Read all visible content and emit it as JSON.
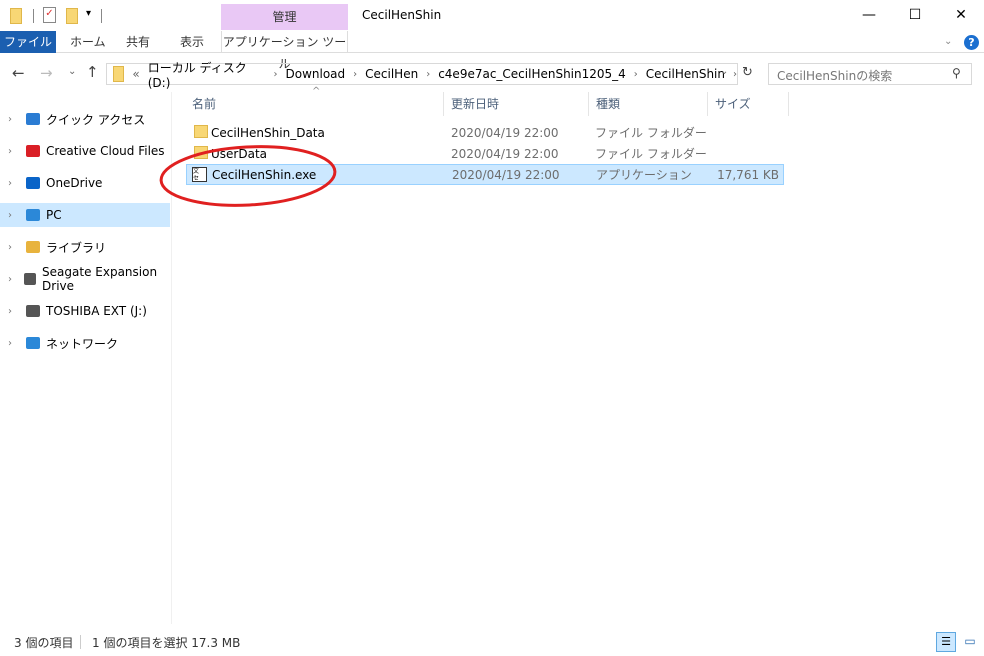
{
  "window": {
    "title": "CecilHenShin",
    "context_tab": "管理",
    "minimize": "—",
    "maximize": "☐",
    "close": "✕"
  },
  "ribbon": {
    "tabs": [
      "ファイル",
      "ホーム",
      "共有",
      "表示",
      "アプリケーション ツール"
    ],
    "help": "?"
  },
  "address": {
    "crumbs": [
      "«",
      "ローカル ディスク (D:)",
      "Download",
      "CecilHen",
      "c4e9e7ac_CecilHenShin1205_4",
      "CecilHenShin"
    ],
    "search_placeholder": "CecilHenShinの検索"
  },
  "sidebar": {
    "items": [
      {
        "label": "クイック アクセス",
        "icon": "star-icon",
        "color": "#2b7cd3"
      },
      {
        "label": "Creative Cloud Files",
        "icon": "creative-cloud-icon",
        "color": "#da1f26"
      },
      {
        "label": "OneDrive",
        "icon": "cloud-icon",
        "color": "#0a64c8"
      },
      {
        "label": "PC",
        "icon": "pc-icon",
        "color": "#2b88d8"
      },
      {
        "label": "ライブラリ",
        "icon": "library-icon",
        "color": "#e8b33d"
      },
      {
        "label": "Seagate Expansion Drive",
        "icon": "drive-icon",
        "color": "#555555"
      },
      {
        "label": "TOSHIBA EXT (J:)",
        "icon": "usb-drive-icon",
        "color": "#555555"
      },
      {
        "label": "ネットワーク",
        "icon": "network-icon",
        "color": "#2b88d8"
      }
    ],
    "selected": "PC"
  },
  "columns": [
    "名前",
    "更新日時",
    "種類",
    "サイズ"
  ],
  "files": [
    {
      "name": "CecilHenShin_Data",
      "date": "2020/04/19 22:00",
      "type": "ファイル フォルダー",
      "size": "",
      "icon": "folder-icon"
    },
    {
      "name": "UserData",
      "date": "2020/04/19 22:00",
      "type": "ファイル フォルダー",
      "size": "",
      "icon": "folder-icon"
    },
    {
      "name": "CecilHenShin.exe",
      "date": "2020/04/19 22:00",
      "type": "アプリケーション",
      "size": "17,761 KB",
      "icon": "app-icon",
      "selected": true
    }
  ],
  "annotation": {
    "color": "#e02020"
  },
  "status": {
    "count": "3 個の項目",
    "selected": "1 個の項目を選択  17.3 MB"
  }
}
